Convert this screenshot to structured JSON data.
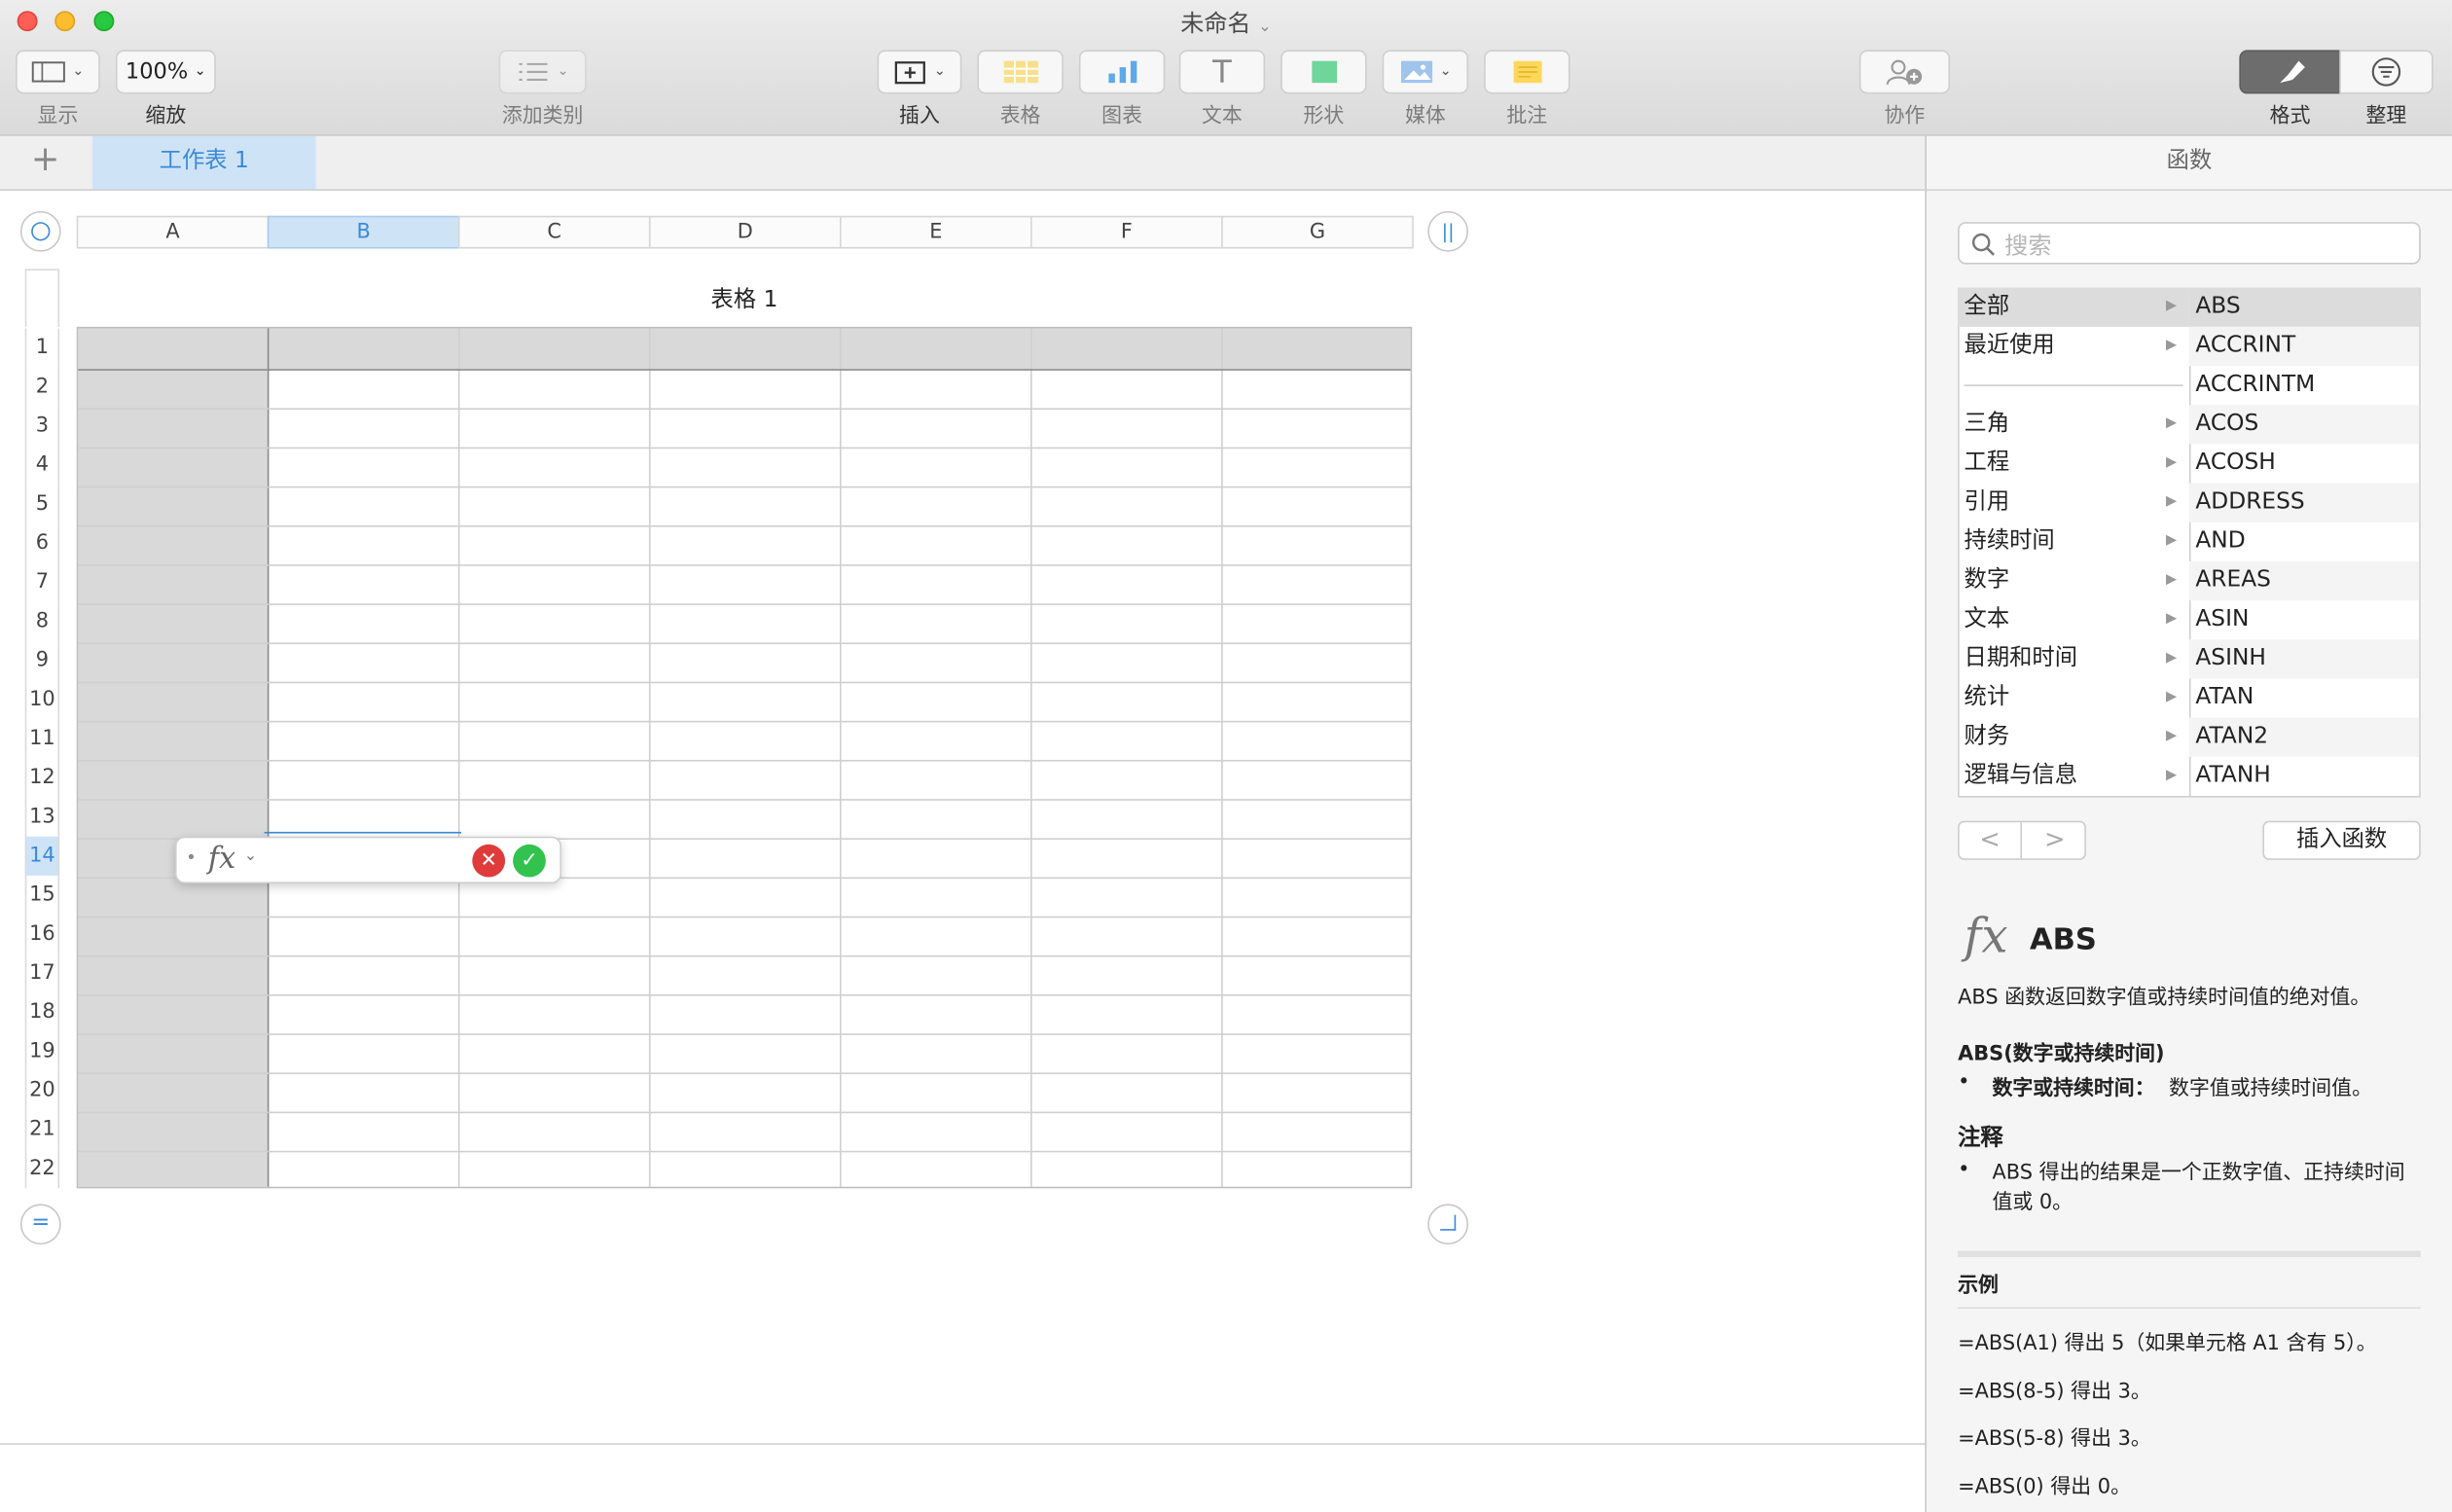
{
  "window": {
    "title": "未命名"
  },
  "toolbar": {
    "view_label": "显示",
    "zoom_value": "100%",
    "zoom_label": "缩放",
    "add_category_label": "添加类别",
    "insert_label": "插入",
    "table_label": "表格",
    "chart_label": "图表",
    "text_label": "文本",
    "shape_label": "形状",
    "media_label": "媒体",
    "comment_label": "批注",
    "collaborate_label": "协作",
    "format_label": "格式",
    "organize_label": "整理"
  },
  "tabs": {
    "add": "+",
    "sheet1": "工作表 1"
  },
  "table": {
    "title": "表格 1",
    "columns": [
      "A",
      "B",
      "C",
      "D",
      "E",
      "F",
      "G"
    ],
    "rows": [
      "1",
      "2",
      "3",
      "4",
      "5",
      "6",
      "7",
      "8",
      "9",
      "10",
      "11",
      "12",
      "13",
      "14",
      "15",
      "16",
      "17",
      "18",
      "19",
      "20",
      "21",
      "22"
    ],
    "selected_column": "B",
    "selected_row": "14"
  },
  "formula_bar": {
    "fx": "fx",
    "cancel": "✕",
    "accept": "✓"
  },
  "sidebar": {
    "title": "函数",
    "search_placeholder": "搜索",
    "categories": [
      "全部",
      "最近使用",
      "",
      "三角",
      "工程",
      "引用",
      "持续时间",
      "数字",
      "文本",
      "日期和时间",
      "统计",
      "财务",
      "逻辑与信息"
    ],
    "functions": [
      "ABS",
      "ACCRINT",
      "ACCRINTM",
      "ACOS",
      "ACOSH",
      "ADDRESS",
      "AND",
      "AREAS",
      "ASIN",
      "ASINH",
      "ATAN",
      "ATAN2",
      "ATANH"
    ],
    "nav_prev": "<",
    "nav_next": ">",
    "insert_function": "插入函数",
    "detail": {
      "fx": "fx",
      "name": "ABS",
      "description": "ABS 函数返回数字值或持续时间值的绝对值。",
      "syntax": "ABS(数字或持续时间)",
      "param_name": "数字或持续时间：",
      "param_desc": "数字值或持续时间值。",
      "notes_title": "注释",
      "note1": "ABS 得出的结果是一个正数字值、正持续时间值或 0。",
      "examples_title": "示例",
      "examples": [
        "=ABS(A1) 得出 5（如果单元格 A1 含有 5）。",
        "=ABS(8-5) 得出 3。",
        "=ABS(5-8) 得出 3。",
        "=ABS(0) 得出 0。"
      ]
    }
  },
  "colors": {
    "accent": "#3a8ad8",
    "selected_tab_bg": "#cfe3f7",
    "header_gray": "#d9d9d9"
  }
}
